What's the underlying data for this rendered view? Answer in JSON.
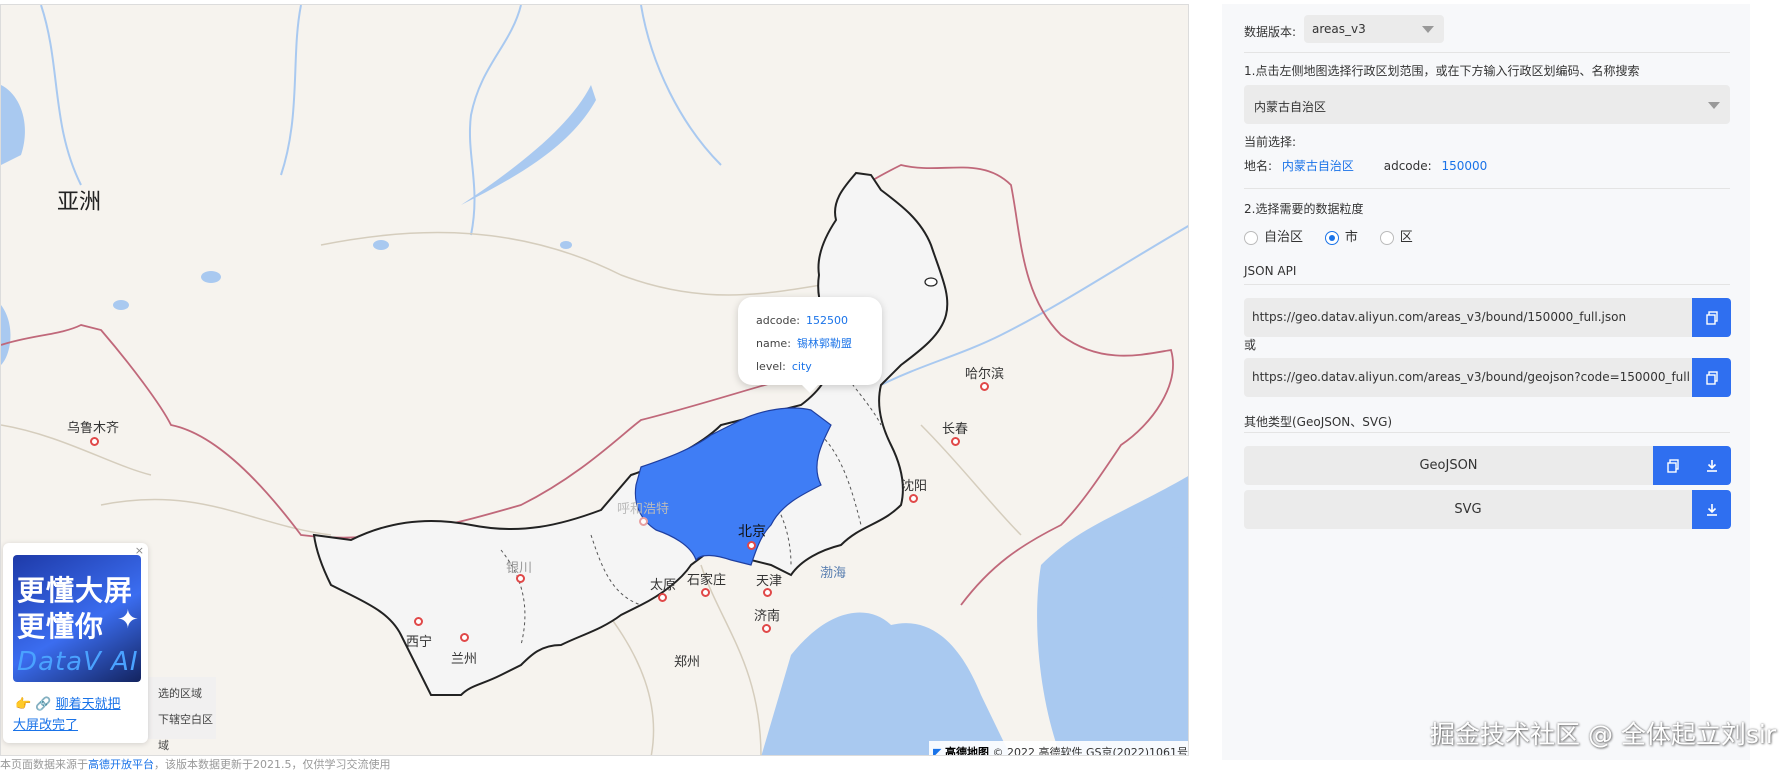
{
  "map": {
    "continent_label": "亚洲",
    "cities": [
      {
        "name": "哈尔滨"
      },
      {
        "name": "长春"
      },
      {
        "name": "沈阳"
      },
      {
        "name": "乌鲁木齐"
      },
      {
        "name": "北京"
      },
      {
        "name": "天津"
      },
      {
        "name": "石家庄"
      },
      {
        "name": "太原"
      },
      {
        "name": "济南"
      },
      {
        "name": "西宁"
      },
      {
        "name": "兰州"
      },
      {
        "name": "郑州"
      },
      {
        "name": "呼和浩特"
      },
      {
        "name": "银川"
      }
    ],
    "sea_label": "渤海",
    "highlight_color": "#3f7df5",
    "tooltip": {
      "adcode_key": "adcode:",
      "adcode": "152500",
      "name_key": "name:",
      "name": "锡林郭勒盟",
      "level_key": "level:",
      "level": "city"
    },
    "promo": {
      "close": "×",
      "banner_line1": "更懂大屏",
      "banner_line2": "更懂你",
      "banner_line3": "DataV AI",
      "emoji": "👉 🔗",
      "link_line1": "聊着天就把",
      "link_line2": "大屏改完了"
    },
    "legend": {
      "item1": "选的区域",
      "item2": "下辖空白区域"
    },
    "attribution": {
      "brand": "高德地图",
      "text": "© 2022 高德软件 GS京(2022)1061号"
    },
    "bottom_note": {
      "prefix": "本页面数据来源于",
      "link": "高德开放平台",
      "suffix": "，该版本数据更新于2021.5，仅供学习交流使用"
    }
  },
  "panel": {
    "version_label": "数据版本:",
    "version_value": "areas_v3",
    "step1": "1.点击左侧地图选择行政区划范围，或在下方输入行政区划编码、名称搜索",
    "region_select": "内蒙古自治区",
    "current_label": "当前选择:",
    "place_key": "地名:",
    "place_value": "内蒙古自治区",
    "adcode_key": "adcode:",
    "adcode_value": "150000",
    "step2": "2.选择需要的数据粒度",
    "radios": [
      {
        "label": "自治区",
        "checked": false
      },
      {
        "label": "市",
        "checked": true
      },
      {
        "label": "区",
        "checked": false
      }
    ],
    "json_api_label": "JSON API",
    "url1": "https://geo.datav.aliyun.com/areas_v3/bound/150000_full.json",
    "or_label": "或",
    "url2": "https://geo.datav.aliyun.com/areas_v3/bound/geojson?code=150000_full",
    "other_types_label": "其他类型(GeoJSON、SVG)",
    "geojson_label": "GeoJSON",
    "svg_label": "SVG"
  },
  "watermark": "掘金技术社区 @ 全体起立刘sir",
  "colors": {
    "accent": "#2f6ff0",
    "link": "#1a73e8"
  }
}
